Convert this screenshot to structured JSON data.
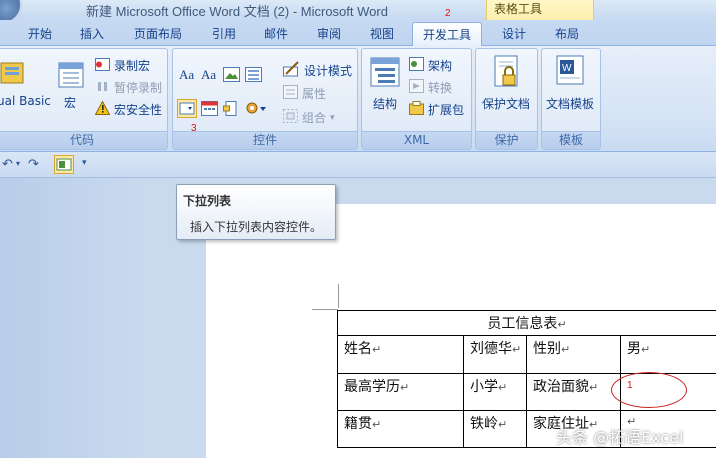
{
  "window": {
    "title": "新建 Microsoft Office Word 文档 (2) - Microsoft Word",
    "contextual_group": "表格工具"
  },
  "annotations": {
    "m1": "1",
    "m2": "2",
    "m3": "3"
  },
  "tabs": [
    "开始",
    "插入",
    "页面布局",
    "引用",
    "邮件",
    "审阅",
    "视图",
    "开发工具",
    "设计",
    "布局"
  ],
  "active_tab": "开发工具",
  "ribbon": {
    "code": {
      "label": "代码",
      "vb_label": "ual Basic",
      "macro_label": "宏",
      "record_macro": "录制宏",
      "pause_record": "暂停录制",
      "macro_security": "宏安全性"
    },
    "controls": {
      "label": "控件",
      "design_mode": "设计模式",
      "properties": "属性",
      "group": "组合"
    },
    "xml": {
      "label": "XML",
      "structure": "结构",
      "schema": "架构",
      "transform": "转换",
      "expansion_pack": "扩展包"
    },
    "protect": {
      "label": "保护",
      "protect_doc": "保护文档"
    },
    "templates": {
      "label": "模板",
      "doc_template": "文档模板"
    }
  },
  "tooltip": {
    "title": "下拉列表",
    "body": "插入下拉列表内容控件。"
  },
  "table": {
    "caption": "员工信息表",
    "rows": [
      [
        "姓名",
        "刘德华",
        "性别",
        "男"
      ],
      [
        "最高学历",
        "小学",
        "政治面貌",
        ""
      ],
      [
        "籍贯",
        "铁岭",
        "家庭住址",
        ""
      ]
    ]
  },
  "watermark": "头条 @拓语Excel",
  "colors": {
    "accent": "#15428b",
    "ribbon_bg": "#d5e3f5",
    "contextual_tab": "#fbeea6",
    "annotation_red": "#cc2222"
  }
}
